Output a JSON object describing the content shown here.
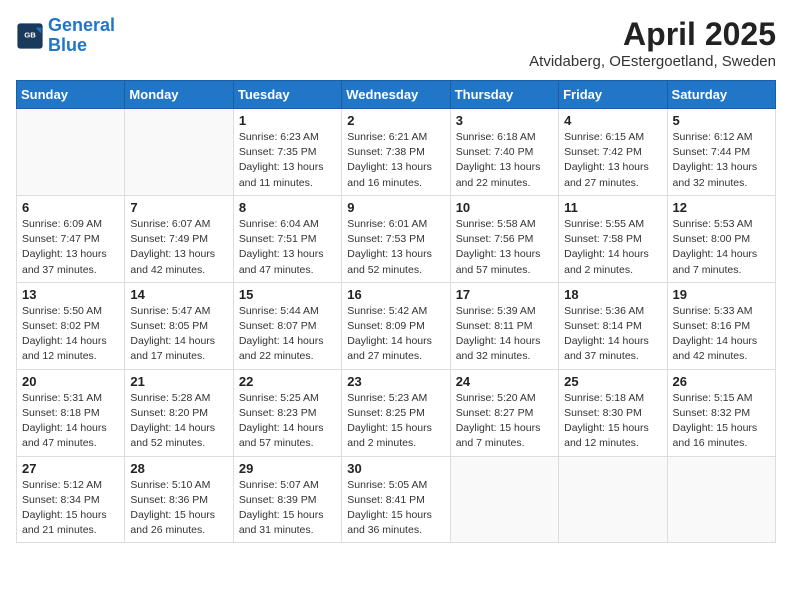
{
  "logo": {
    "line1": "General",
    "line2": "Blue"
  },
  "title": {
    "month_year": "April 2025",
    "location": "Atvidaberg, OEstergoetland, Sweden"
  },
  "weekdays": [
    "Sunday",
    "Monday",
    "Tuesday",
    "Wednesday",
    "Thursday",
    "Friday",
    "Saturday"
  ],
  "weeks": [
    [
      {
        "day": "",
        "info": ""
      },
      {
        "day": "",
        "info": ""
      },
      {
        "day": "1",
        "info": "Sunrise: 6:23 AM\nSunset: 7:35 PM\nDaylight: 13 hours\nand 11 minutes."
      },
      {
        "day": "2",
        "info": "Sunrise: 6:21 AM\nSunset: 7:38 PM\nDaylight: 13 hours\nand 16 minutes."
      },
      {
        "day": "3",
        "info": "Sunrise: 6:18 AM\nSunset: 7:40 PM\nDaylight: 13 hours\nand 22 minutes."
      },
      {
        "day": "4",
        "info": "Sunrise: 6:15 AM\nSunset: 7:42 PM\nDaylight: 13 hours\nand 27 minutes."
      },
      {
        "day": "5",
        "info": "Sunrise: 6:12 AM\nSunset: 7:44 PM\nDaylight: 13 hours\nand 32 minutes."
      }
    ],
    [
      {
        "day": "6",
        "info": "Sunrise: 6:09 AM\nSunset: 7:47 PM\nDaylight: 13 hours\nand 37 minutes."
      },
      {
        "day": "7",
        "info": "Sunrise: 6:07 AM\nSunset: 7:49 PM\nDaylight: 13 hours\nand 42 minutes."
      },
      {
        "day": "8",
        "info": "Sunrise: 6:04 AM\nSunset: 7:51 PM\nDaylight: 13 hours\nand 47 minutes."
      },
      {
        "day": "9",
        "info": "Sunrise: 6:01 AM\nSunset: 7:53 PM\nDaylight: 13 hours\nand 52 minutes."
      },
      {
        "day": "10",
        "info": "Sunrise: 5:58 AM\nSunset: 7:56 PM\nDaylight: 13 hours\nand 57 minutes."
      },
      {
        "day": "11",
        "info": "Sunrise: 5:55 AM\nSunset: 7:58 PM\nDaylight: 14 hours\nand 2 minutes."
      },
      {
        "day": "12",
        "info": "Sunrise: 5:53 AM\nSunset: 8:00 PM\nDaylight: 14 hours\nand 7 minutes."
      }
    ],
    [
      {
        "day": "13",
        "info": "Sunrise: 5:50 AM\nSunset: 8:02 PM\nDaylight: 14 hours\nand 12 minutes."
      },
      {
        "day": "14",
        "info": "Sunrise: 5:47 AM\nSunset: 8:05 PM\nDaylight: 14 hours\nand 17 minutes."
      },
      {
        "day": "15",
        "info": "Sunrise: 5:44 AM\nSunset: 8:07 PM\nDaylight: 14 hours\nand 22 minutes."
      },
      {
        "day": "16",
        "info": "Sunrise: 5:42 AM\nSunset: 8:09 PM\nDaylight: 14 hours\nand 27 minutes."
      },
      {
        "day": "17",
        "info": "Sunrise: 5:39 AM\nSunset: 8:11 PM\nDaylight: 14 hours\nand 32 minutes."
      },
      {
        "day": "18",
        "info": "Sunrise: 5:36 AM\nSunset: 8:14 PM\nDaylight: 14 hours\nand 37 minutes."
      },
      {
        "day": "19",
        "info": "Sunrise: 5:33 AM\nSunset: 8:16 PM\nDaylight: 14 hours\nand 42 minutes."
      }
    ],
    [
      {
        "day": "20",
        "info": "Sunrise: 5:31 AM\nSunset: 8:18 PM\nDaylight: 14 hours\nand 47 minutes."
      },
      {
        "day": "21",
        "info": "Sunrise: 5:28 AM\nSunset: 8:20 PM\nDaylight: 14 hours\nand 52 minutes."
      },
      {
        "day": "22",
        "info": "Sunrise: 5:25 AM\nSunset: 8:23 PM\nDaylight: 14 hours\nand 57 minutes."
      },
      {
        "day": "23",
        "info": "Sunrise: 5:23 AM\nSunset: 8:25 PM\nDaylight: 15 hours\nand 2 minutes."
      },
      {
        "day": "24",
        "info": "Sunrise: 5:20 AM\nSunset: 8:27 PM\nDaylight: 15 hours\nand 7 minutes."
      },
      {
        "day": "25",
        "info": "Sunrise: 5:18 AM\nSunset: 8:30 PM\nDaylight: 15 hours\nand 12 minutes."
      },
      {
        "day": "26",
        "info": "Sunrise: 5:15 AM\nSunset: 8:32 PM\nDaylight: 15 hours\nand 16 minutes."
      }
    ],
    [
      {
        "day": "27",
        "info": "Sunrise: 5:12 AM\nSunset: 8:34 PM\nDaylight: 15 hours\nand 21 minutes."
      },
      {
        "day": "28",
        "info": "Sunrise: 5:10 AM\nSunset: 8:36 PM\nDaylight: 15 hours\nand 26 minutes."
      },
      {
        "day": "29",
        "info": "Sunrise: 5:07 AM\nSunset: 8:39 PM\nDaylight: 15 hours\nand 31 minutes."
      },
      {
        "day": "30",
        "info": "Sunrise: 5:05 AM\nSunset: 8:41 PM\nDaylight: 15 hours\nand 36 minutes."
      },
      {
        "day": "",
        "info": ""
      },
      {
        "day": "",
        "info": ""
      },
      {
        "day": "",
        "info": ""
      }
    ]
  ]
}
